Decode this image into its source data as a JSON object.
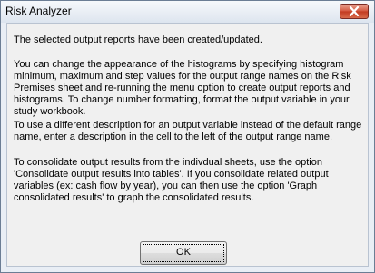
{
  "window": {
    "title": "Risk Analyzer",
    "close_icon": "close-x-icon"
  },
  "message": {
    "p1": "The selected output reports have been created/updated.",
    "p2": "You can change the appearance of the histograms by specifying histogram\nminimum, maximum and step values for the output range names on the Risk\nPremises sheet and re-running the menu option to create output reports and\nhistograms.  To change number formatting, format the output variable in your\nstudy workbook.",
    "p3": "To use a different description for an output variable instead of the default range\nname, enter a description in the cell to the left of the output range name.",
    "p4": "To consolidate output results from the indivdual sheets, use the option\n'Consolidate output results into tables'.  If you consolidate related output\nvariables (ex: cash flow by year), you can then use the option 'Graph\nconsolidated results' to graph the consolidated results."
  },
  "buttons": {
    "ok_label": "OK"
  }
}
